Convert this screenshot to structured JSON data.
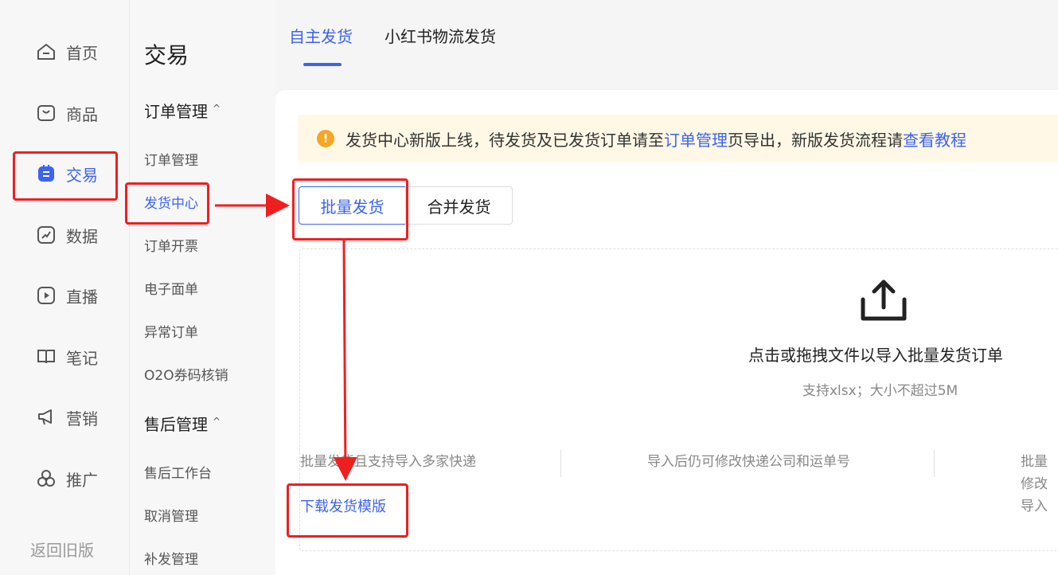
{
  "nav1": {
    "items": [
      {
        "label": "首页",
        "icon": "home-icon"
      },
      {
        "label": "商品",
        "icon": "bag-icon"
      },
      {
        "label": "交易",
        "icon": "trade-icon",
        "active": true
      },
      {
        "label": "数据",
        "icon": "chart-icon"
      },
      {
        "label": "直播",
        "icon": "play-icon"
      },
      {
        "label": "笔记",
        "icon": "book-icon"
      },
      {
        "label": "营销",
        "icon": "megaphone-icon"
      },
      {
        "label": "推广",
        "icon": "circles-icon"
      }
    ],
    "old_version": "返回旧版"
  },
  "nav2": {
    "title": "交易",
    "group_order": "订单管理",
    "order_items": [
      "订单管理",
      "发货中心",
      "订单开票",
      "电子面单",
      "异常订单",
      "O2O券码核销"
    ],
    "group_aftersale": "售后管理",
    "aftersale_items": [
      "售后工作台",
      "取消管理",
      "补发管理"
    ]
  },
  "top_tabs": [
    "自主发货",
    "小红书物流发货"
  ],
  "notice": {
    "part1": "发货中心新版上线，待发货及已发货订单请至",
    "link1": "订单管理",
    "part2": "页导出，新版发货流程请",
    "link2": "查看教程"
  },
  "segments": [
    "批量发货",
    "合并发货"
  ],
  "dropzone": {
    "title": "点击或拖拽文件以导入批量发货订单",
    "subtitle": "支持xlsx；大小不超过5M"
  },
  "tips": {
    "tip1": "批量发货且支持导入多家快递",
    "tip2": "导入后仍可修改快递公司和运单号",
    "tip3": "批量修改导入"
  },
  "download_label": "下载发货模版",
  "colors": {
    "accent": "#3d63f0",
    "annotation": "#f01f1f",
    "warning": "#f5a623"
  }
}
